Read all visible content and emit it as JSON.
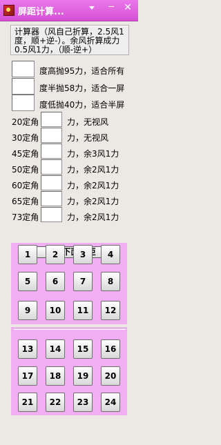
{
  "titlebar": {
    "title": "屏距计算...",
    "close_glyph": "✕"
  },
  "description": "计算器（风自己折算，2.5风1度，顺+逆-）。余风折算成力0.5风1力，（顺-逆+）",
  "degree_rows": [
    {
      "label": "度高抛95力，适合所有"
    },
    {
      "label": "度半抛58力，适合一屏"
    },
    {
      "label": "度低抛40力，适合半屏"
    }
  ],
  "angle_rows": [
    {
      "prefix": "20定角",
      "suffix": "力，无视风"
    },
    {
      "prefix": "30定角",
      "suffix": "力，无视风"
    },
    {
      "prefix": "45定角",
      "suffix": "力，余3风1力"
    },
    {
      "prefix": "50定角",
      "suffix": "力，余2风1力"
    },
    {
      "prefix": "60定角",
      "suffix": "力，余2风1力"
    },
    {
      "prefix": "65定角",
      "suffix": "力，余2风1力"
    },
    {
      "prefix": "73定角",
      "suffix": "力，余2风1力"
    }
  ],
  "screen": {
    "header_label": "点击下面屏距",
    "buttons": [
      "1",
      "2",
      "3",
      "4",
      "5",
      "6",
      "7",
      "8",
      "9",
      "10",
      "11",
      "12",
      "13",
      "14",
      "15",
      "16",
      "17",
      "18",
      "19",
      "20",
      "21",
      "22",
      "23",
      "24"
    ]
  },
  "colors": {
    "titlebar": "#df5edf",
    "panel": "#f2aef2",
    "window": "#ece9e4"
  }
}
